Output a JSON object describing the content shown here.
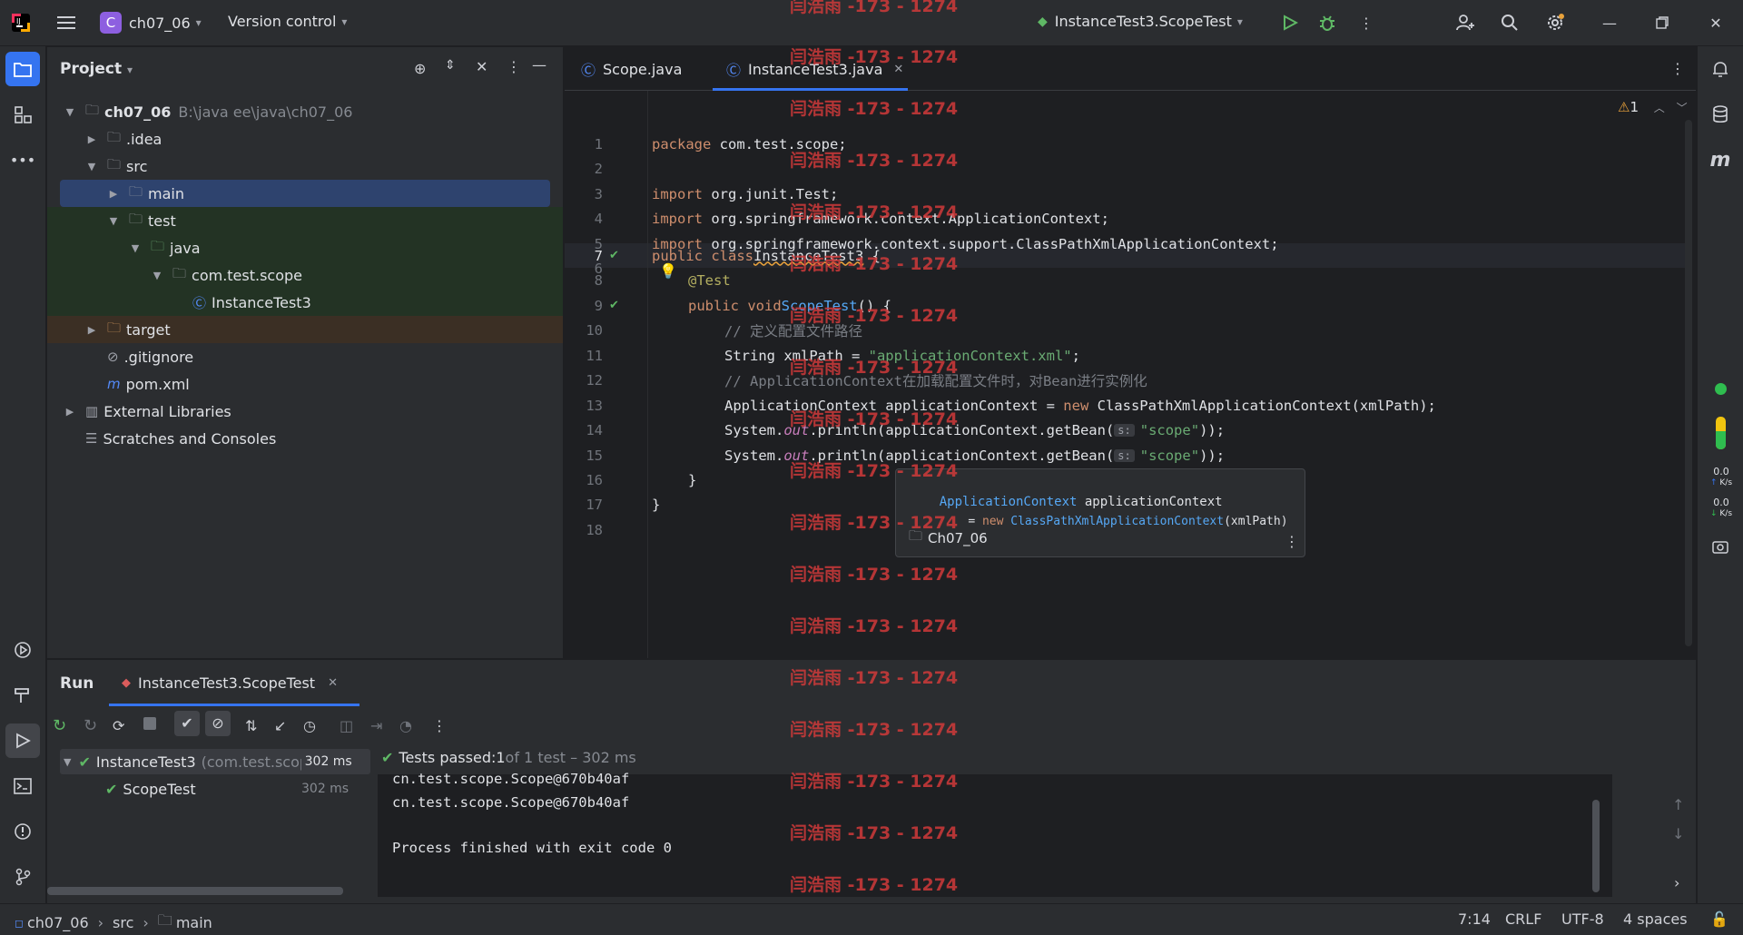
{
  "titlebar": {
    "project_letter": "C",
    "project_name": "ch07_06",
    "vcs_label": "Version control",
    "run_config": "InstanceTest3.ScopeTest"
  },
  "project_panel": {
    "title": "Project",
    "tree": [
      {
        "label": "ch07_06",
        "detail": "B:\\java ee\\java\\ch07_06"
      },
      {
        "label": ".idea"
      },
      {
        "label": "src"
      },
      {
        "label": "main"
      },
      {
        "label": "test"
      },
      {
        "label": "java"
      },
      {
        "label": "com.test.scope"
      },
      {
        "label": "InstanceTest3"
      },
      {
        "label": "target"
      },
      {
        "label": ".gitignore"
      },
      {
        "label": "pom.xml"
      },
      {
        "label": "External Libraries"
      },
      {
        "label": "Scratches and Consoles"
      }
    ]
  },
  "editor": {
    "tabs": [
      {
        "label": "Scope.java"
      },
      {
        "label": "InstanceTest3.java"
      }
    ],
    "warning_count": "1",
    "line_numbers": [
      "1",
      "2",
      "3",
      "4",
      "5",
      "6",
      "7",
      "8",
      "9",
      "10",
      "11",
      "12",
      "13",
      "14",
      "15",
      "16",
      "17",
      "18"
    ],
    "code": {
      "l1_kw": "package",
      "l1_rest": " com.test.scope;",
      "l3_kw": "import",
      "l3_rest": " org.junit.Test;",
      "l4_kw": "import",
      "l4_rest": " org.springframework.context.ApplicationContext;",
      "l5_kw": "import",
      "l5_rest": " org.springframework.context.support.ClassPathXmlApplicationContext;",
      "l7_kw": "public class",
      "l7_name": "InstanceTest3",
      "l7_rest": " {",
      "l8_an": "@Test",
      "l9_kw": "public void",
      "l9_name": "ScopeTest",
      "l9_rest": "() {",
      "l10_cm": "// 定义配置文件路径",
      "l11_a": "String xmlPath = ",
      "l11_str": "\"applicationContext.xml\"",
      "l11_b": ";",
      "l12_cm": "// ApplicationContext在加载配置文件时，对Bean进行实例化",
      "l13_a": "ApplicationContext applicationContext = ",
      "l13_kw": "new",
      "l13_b": " ClassPathXmlApplicationContext(xmlPath);",
      "l14_a": "System.",
      "l14_it": "out",
      "l14_b": ".println(applicationContext.getBean(",
      "l14_hint": "s:",
      "l14_str": "\"scope\"",
      "l14_c": "));",
      "l15_a": "System.",
      "l15_it": "out",
      "l15_b": ".println(applicationContext.getBean(",
      "l15_hint": "s:",
      "l15_str": "\"scope\"",
      "l15_c": "));",
      "l16": "}",
      "l17": "}"
    },
    "popup": {
      "type": "ApplicationContext",
      "var": " applicationContext",
      "eq": "= ",
      "kw": "new",
      "cls": " ClassPathXmlApplicationContext",
      "args": "(xmlPath)",
      "module": "Ch07_06"
    }
  },
  "run_panel": {
    "title": "Run",
    "tab_label": "InstanceTest3.ScopeTest",
    "tests": [
      {
        "name": "InstanceTest3",
        "detail": "(com.test.scop",
        "time": "302 ms"
      },
      {
        "name": "ScopeTest",
        "time": "302 ms"
      }
    ],
    "status_prefix": "Tests passed: ",
    "status_count": "1",
    "status_suffix": " of 1 test – 302 ms",
    "console": [
      "cn.test.scope.Scope@670b40af",
      "cn.test.scope.Scope@670b40af",
      "",
      "Process finished with exit code 0"
    ]
  },
  "sidebar_right": {
    "net_up": "0.0",
    "net_down": "0.0",
    "net_unit": "K/s"
  },
  "statusbar": {
    "crumbs": [
      "ch07_06",
      "src",
      "main"
    ],
    "position": "7:14",
    "line_sep": "CRLF",
    "encoding": "UTF-8",
    "indent": "4 spaces"
  },
  "watermark": "闫浩雨 -173 - 1274",
  "colors": {
    "accent": "#3574f0",
    "success": "#5fb865",
    "keyword": "#cf8e6d",
    "string": "#6aab73"
  }
}
